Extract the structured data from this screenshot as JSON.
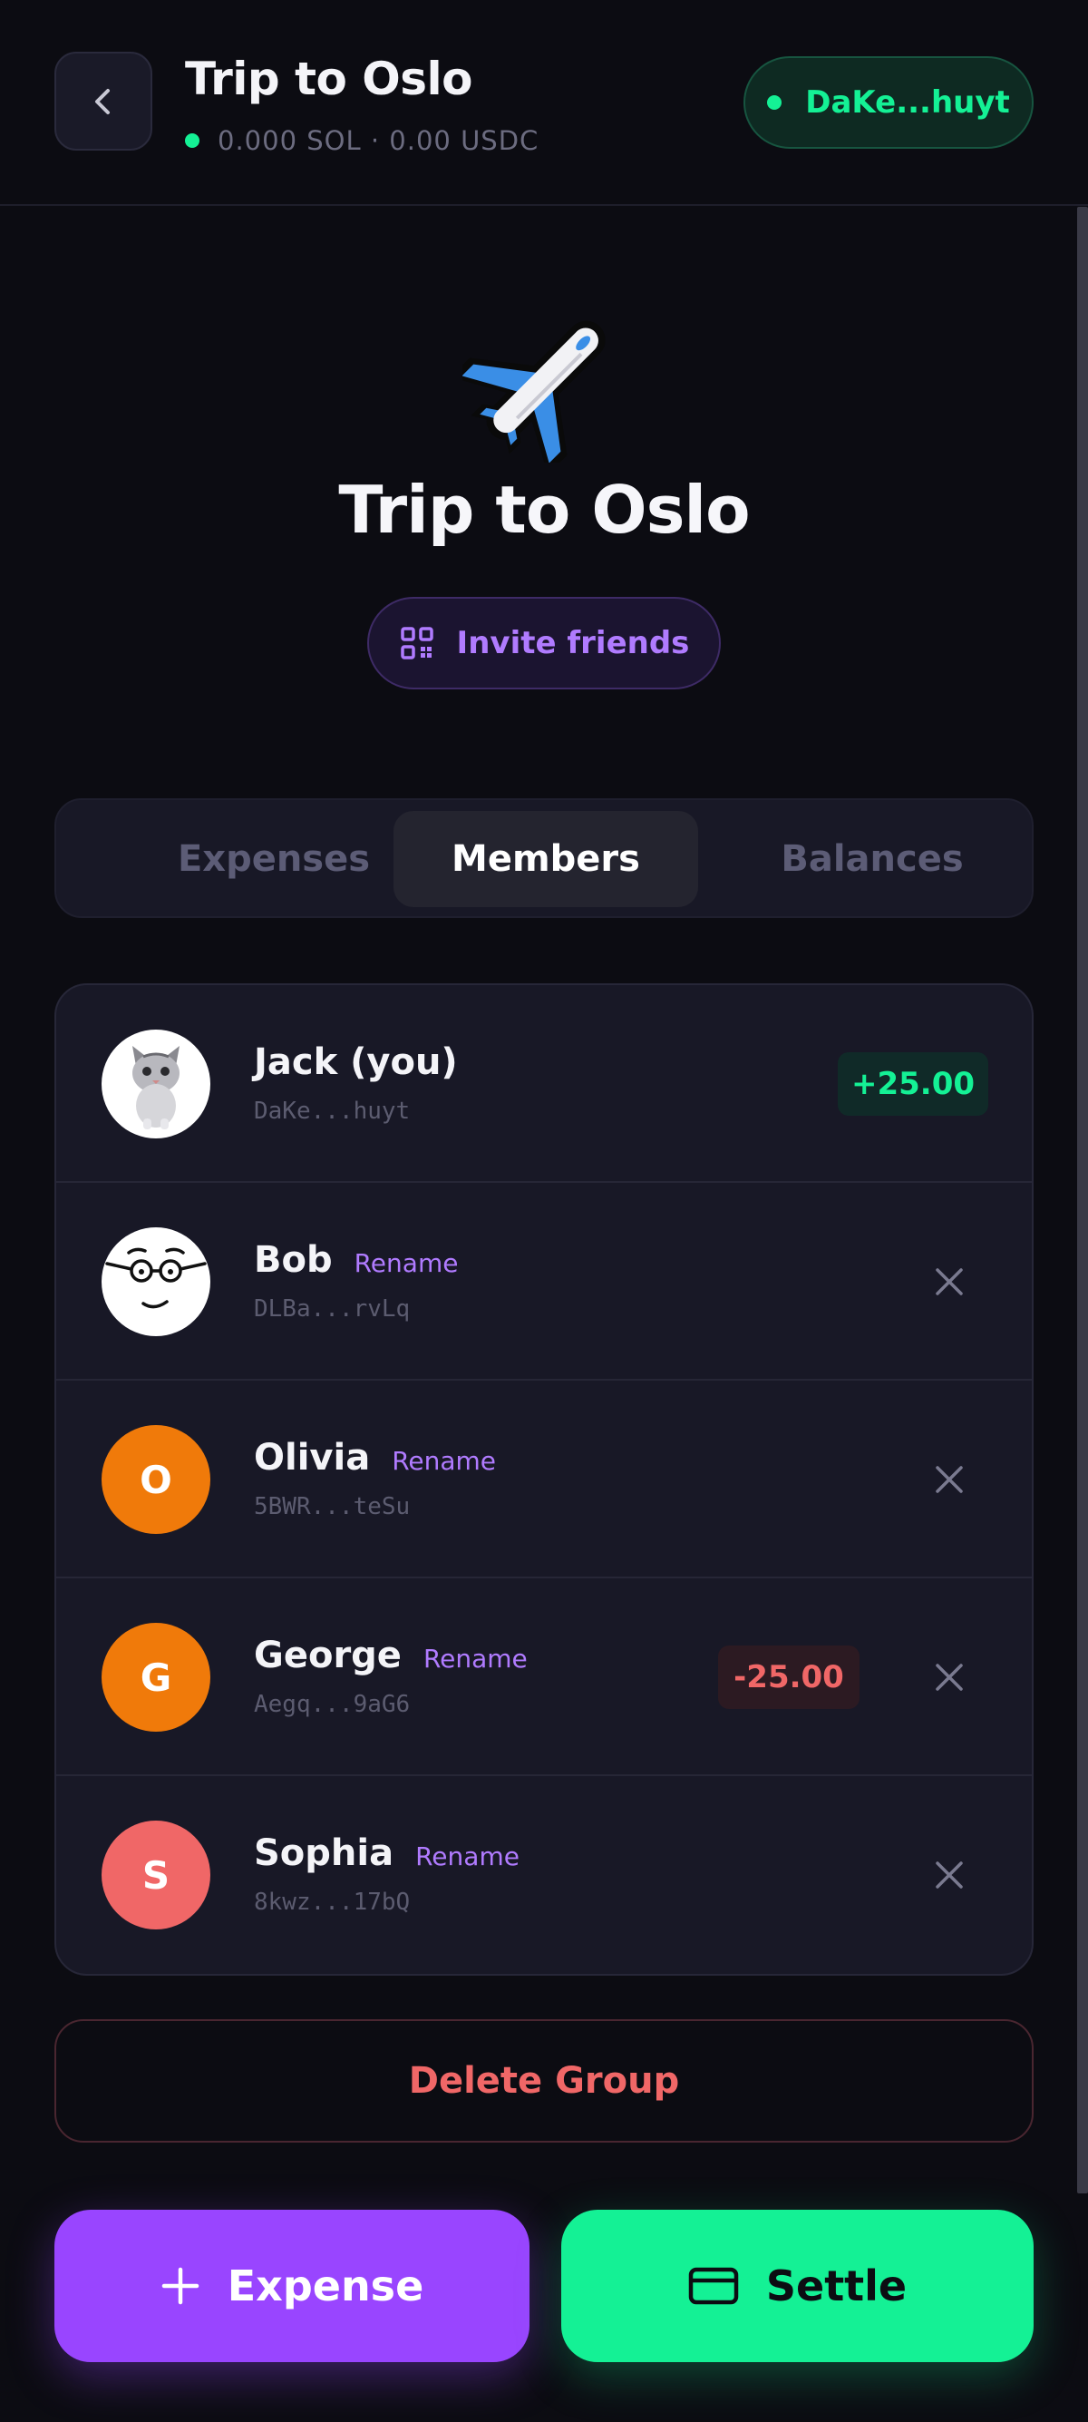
{
  "header": {
    "title": "Trip to Oslo",
    "balance_text": "0.000 SOL · 0.00 USDC",
    "wallet_label": "DaKe...huyt"
  },
  "hero": {
    "emoji": "airplane-icon",
    "title": "Trip to Oslo",
    "invite_label": "Invite friends"
  },
  "tabs": [
    {
      "label": "Expenses",
      "active": false
    },
    {
      "label": "Members",
      "active": true
    },
    {
      "label": "Balances",
      "active": false
    }
  ],
  "members": [
    {
      "name": "Jack (you)",
      "address": "DaKe...huyt",
      "avatar": "kitten-photo",
      "rename": "",
      "balance": "+25.00",
      "balance_type": "positive",
      "removable": false
    },
    {
      "name": "Bob",
      "address": "DLBa...rvLq",
      "avatar": "face-with-glasses",
      "rename": "Rename",
      "balance": "",
      "removable": true
    },
    {
      "name": "Olivia",
      "address": "5BWR...teSu",
      "avatar_letter": "O",
      "avatar_color": "#f07a0a",
      "rename": "Rename",
      "balance": "",
      "removable": true
    },
    {
      "name": "George",
      "address": "Aegq...9aG6",
      "avatar_letter": "G",
      "avatar_color": "#f07a0a",
      "rename": "Rename",
      "balance": "-25.00",
      "balance_type": "negative",
      "removable": true
    },
    {
      "name": "Sophia",
      "address": "8kwz...17bQ",
      "avatar_letter": "S",
      "avatar_color": "#f06767",
      "rename": "Rename",
      "balance": "",
      "removable": true
    }
  ],
  "actions": {
    "delete_label": "Delete Group",
    "expense_label": "Expense",
    "settle_label": "Settle"
  },
  "colors": {
    "background": "#0c0c12",
    "accent_purple": "#9945ff",
    "accent_green": "#14f195",
    "danger": "#f06767",
    "card": "#181826"
  }
}
